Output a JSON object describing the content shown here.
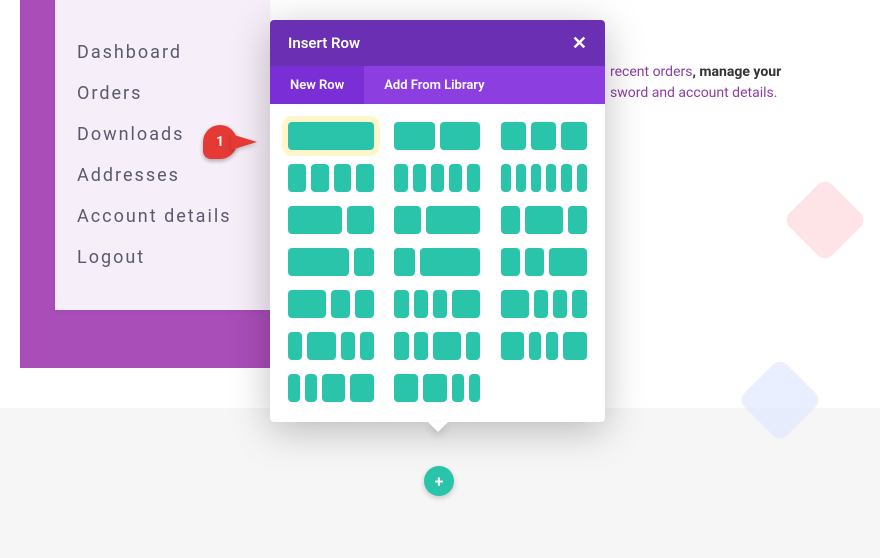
{
  "sidebar": {
    "items": [
      {
        "label": "Dashboard"
      },
      {
        "label": "Orders"
      },
      {
        "label": "Downloads"
      },
      {
        "label": "Addresses"
      },
      {
        "label": "Account details"
      },
      {
        "label": "Logout"
      }
    ]
  },
  "bg_text": {
    "line1a": "recent orders",
    "line1b": ", manage your",
    "line2": "sword and account details."
  },
  "modal": {
    "title": "Insert Row",
    "close": "✕",
    "tabs": {
      "new_row": "New Row",
      "add_library": "Add From Library"
    },
    "layouts": [
      [
        [
          1
        ],
        [
          1,
          1
        ],
        [
          1,
          1,
          1
        ]
      ],
      [
        [
          1,
          1,
          1,
          1
        ],
        [
          1,
          1,
          1,
          1,
          1
        ],
        [
          1,
          1,
          1,
          1,
          1,
          1
        ]
      ],
      [
        [
          2,
          1
        ],
        [
          1,
          2
        ],
        [
          1,
          2,
          1
        ]
      ],
      [
        [
          3,
          1
        ],
        [
          1,
          3
        ],
        [
          1,
          1,
          2
        ]
      ],
      [
        [
          2,
          1,
          1
        ],
        [
          1,
          1,
          1,
          2
        ],
        [
          2,
          1,
          1,
          1
        ]
      ],
      [
        [
          1,
          2,
          1,
          1
        ],
        [
          1,
          1,
          2,
          1
        ],
        [
          2,
          1,
          1,
          2
        ]
      ],
      [
        [
          1,
          1,
          2,
          2
        ],
        [
          2,
          2,
          1,
          1
        ]
      ]
    ]
  },
  "annotation": {
    "label": "1"
  },
  "add_button": {
    "glyph": "+"
  },
  "colors": {
    "purple_dark": "#6b2fb3",
    "purple_mid": "#8c3ee0",
    "purple_accent": "#a94db8",
    "teal": "#29c4a9",
    "red": "#e53935"
  }
}
